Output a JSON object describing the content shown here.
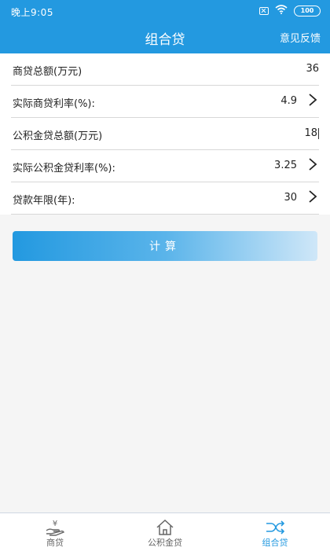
{
  "status": {
    "time": "晚上9:05",
    "battery": "100"
  },
  "header": {
    "title": "组合贷",
    "feedback": "意见反馈"
  },
  "form": {
    "rows": [
      {
        "label": "商贷总额(万元)",
        "value": "36"
      },
      {
        "label": "实际商贷利率(%):",
        "value": "4.9"
      },
      {
        "label": "公积金贷总额(万元)",
        "value": "18"
      },
      {
        "label": "实际公积金贷利率(%):",
        "value": "3.25"
      },
      {
        "label": "贷款年限(年):",
        "value": "30"
      }
    ]
  },
  "calc_button": "计算",
  "tabs": [
    {
      "label": "商贷",
      "icon": "yen-hand-icon"
    },
    {
      "label": "公积金贷",
      "icon": "house-icon"
    },
    {
      "label": "组合贷",
      "icon": "shuffle-icon"
    }
  ],
  "colors": {
    "primary": "#2399e0",
    "bg": "#f5f5f5"
  }
}
